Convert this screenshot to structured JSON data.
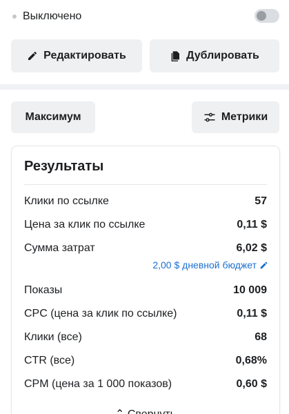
{
  "status": {
    "label": "Выключено",
    "toggle_on": false
  },
  "actions": {
    "edit_label": "Редактировать",
    "duplicate_label": "Дублировать"
  },
  "controls": {
    "max_label": "Максимум",
    "metrics_label": "Метрики"
  },
  "results": {
    "title": "Результаты",
    "budget_note": "2,00 $ дневной бюджет",
    "rows": [
      {
        "label": "Клики по ссылке",
        "value": "57"
      },
      {
        "label": "Цена за клик по ссылке",
        "value": "0,11 $"
      },
      {
        "label": "Сумма затрат",
        "value": "6,02 $"
      },
      {
        "label": "Показы",
        "value": "10 009"
      },
      {
        "label": "CPC (цена за клик по ссылке)",
        "value": "0,11 $"
      },
      {
        "label": "Клики (все)",
        "value": "68"
      },
      {
        "label": "CTR (все)",
        "value": "0,68%"
      },
      {
        "label": "CPM (цена за 1 000 показов)",
        "value": "0,60 $"
      }
    ],
    "collapse_label": "Свернуть"
  }
}
